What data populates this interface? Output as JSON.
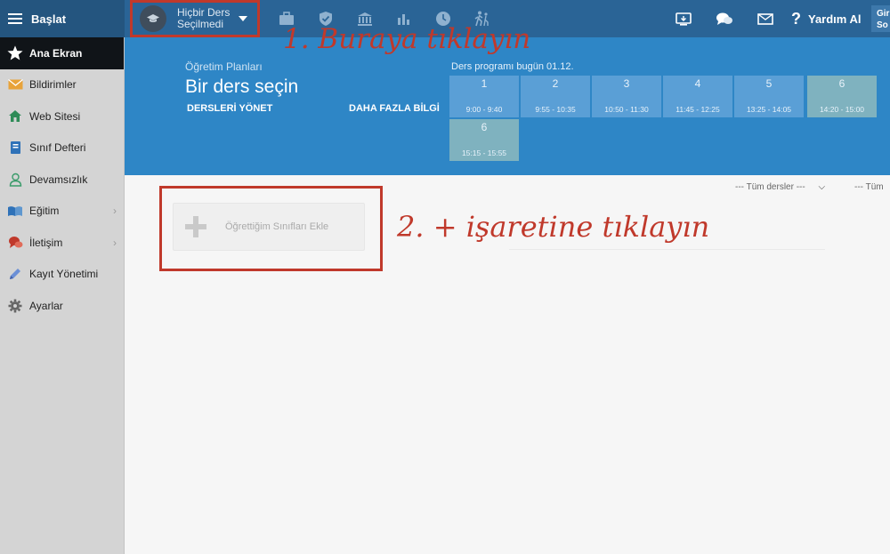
{
  "topbar": {
    "menu_label": "Başlat",
    "course_line1": "Hiçbir Ders",
    "course_line2": "Seçilmedi",
    "help_label": "Yardım Al",
    "login_line1": "Giri",
    "login_line2": "So"
  },
  "sidebar": {
    "items": [
      {
        "label": "Ana Ekran",
        "icon": "star-icon"
      },
      {
        "label": "Bildirimler",
        "icon": "envelope-icon"
      },
      {
        "label": "Web Sitesi",
        "icon": "house-icon"
      },
      {
        "label": "Sınıf Defteri",
        "icon": "book-icon"
      },
      {
        "label": "Devamsızlık",
        "icon": "person-icon"
      },
      {
        "label": "Eğitim",
        "icon": "open-book-icon"
      },
      {
        "label": "İletişim",
        "icon": "chat-icon"
      },
      {
        "label": "Kayıt Yönetimi",
        "icon": "pencil-icon"
      },
      {
        "label": "Ayarlar",
        "icon": "gear-icon"
      }
    ]
  },
  "header": {
    "subtitle": "Öğretim Planları",
    "title": "Bir ders seçin",
    "manage_link": "DERSLERİ YÖNET",
    "more_info_link": "DAHA FAZLA BİLGİ",
    "schedule_title": "Ders programı bugün 01.12.",
    "slots": [
      {
        "num": "1",
        "time": "9:00 - 9:40"
      },
      {
        "num": "2",
        "time": "9:55 - 10:35"
      },
      {
        "num": "3",
        "time": "10:50 - 11:30"
      },
      {
        "num": "4",
        "time": "11:45 - 12:25"
      },
      {
        "num": "5",
        "time": "13:25 - 14:05"
      },
      {
        "num": "6",
        "time": "14:20 - 15:00"
      },
      {
        "num": "6",
        "time": "15:15 - 15:55"
      }
    ]
  },
  "content": {
    "filter1": "--- Tüm dersler ---",
    "filter2": "--- Tüm",
    "add_label": "Öğrettiğim Sınıfları Ekle"
  },
  "annotations": {
    "step1": "1. Buraya tıklayın",
    "step2": "2. + işaretine tıklayın"
  },
  "colors": {
    "topbar": "#2a6496",
    "hero": "#2e86c6",
    "slot": "#5a9fd6",
    "slot_highlight": "#7fb2bf",
    "annotation": "#c0392b"
  }
}
